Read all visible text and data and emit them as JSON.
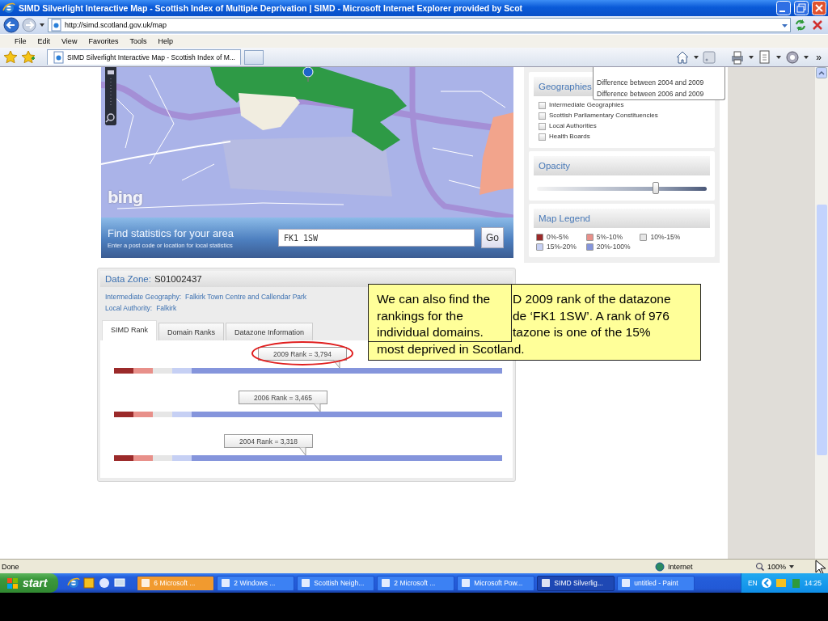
{
  "window": {
    "title": "SIMD Silverlight Interactive Map - Scottish Index of Multiple Deprivation | SIMD - Microsoft Internet Explorer provided by Scot"
  },
  "address_bar": {
    "url": "http://simd.scotland.gov.uk/map"
  },
  "menu": [
    "File",
    "Edit",
    "View",
    "Favorites",
    "Tools",
    "Help"
  ],
  "tabs": [
    {
      "label": "SIMD Silverlight Interactive Map - Scottish Index of M...",
      "selected": true
    }
  ],
  "toolbar_chevron": "»",
  "map": {
    "logo": "bing",
    "search": {
      "title": "Find statistics for your area",
      "hint": "Enter a post code or location for local statistics",
      "value": "FK1 1SW",
      "button": "Go"
    }
  },
  "side_panel": {
    "comparison_menu": [
      "Difference between 2004 and 2009",
      "Difference between 2006 and 2009"
    ],
    "geographies": {
      "title": "Geographies",
      "options": [
        {
          "label": "Intermediate Geographies",
          "checked": false
        },
        {
          "label": "Scottish Parliamentary Constituencies",
          "checked": false
        },
        {
          "label": "Local Authorities",
          "checked": false
        },
        {
          "label": "Health Boards",
          "checked": false
        }
      ]
    },
    "opacity": {
      "title": "Opacity",
      "level": 0.7
    },
    "legend": {
      "title": "Map Legend",
      "items": [
        {
          "label": "0%-5%",
          "color": "#9b2a2a"
        },
        {
          "label": "5%-10%",
          "color": "#e8908a"
        },
        {
          "label": "10%-15%",
          "color": "#e6e6e6"
        },
        {
          "label": "15%-20%",
          "color": "#c6d0f4"
        },
        {
          "label": "20%-100%",
          "color": "#8595dc"
        }
      ]
    }
  },
  "data_zone": {
    "label": "Data Zone:",
    "value": "S01002437",
    "details": [
      {
        "label": "Intermediate Geography:",
        "value": "Falkirk Town Centre and Callendar Park"
      },
      {
        "label": "Local Authority:",
        "value": "Falkirk"
      }
    ],
    "tabs": [
      {
        "label": "SIMD Rank",
        "selected": true
      },
      {
        "label": "Domain Ranks",
        "selected": false
      },
      {
        "label": "Datazone Information",
        "selected": false
      }
    ],
    "ranks": [
      {
        "label": "2009 Rank = 3,794",
        "level": 0.583,
        "circled": true
      },
      {
        "label": "2006 Rank = 3,465",
        "level": 0.533,
        "circled": false
      },
      {
        "label": "2004 Rank = 3,318",
        "level": 0.496,
        "circled": false
      }
    ]
  },
  "callouts": [
    {
      "text": "We can also find the rankings for the individual domains."
    },
    {
      "lines": [
        "D 2009 rank of the datazone",
        "de ‘FK1 1SW’. A rank of 976",
        "tazone is one of the 15%",
        "most deprived in Scotland."
      ]
    }
  ],
  "status_bar": {
    "text": "Done",
    "zone": "Internet",
    "zoom": "100%"
  },
  "taskbar": {
    "start": "start",
    "tasks": [
      {
        "label": "6 Microsoft ...",
        "selected": false,
        "flashing": true
      },
      {
        "label": "2 Windows ...",
        "selected": false,
        "flashing": false
      },
      {
        "label": "Scottish Neigh...",
        "selected": false,
        "flashing": false
      },
      {
        "label": "2 Microsoft ...",
        "selected": false,
        "flashing": false
      },
      {
        "label": "Microsoft Pow...",
        "selected": false,
        "flashing": false
      },
      {
        "label": "SIMD Silverlig...",
        "selected": true,
        "flashing": false
      },
      {
        "label": "untitled - Paint",
        "selected": false,
        "flashing": false
      }
    ],
    "language": "EN",
    "clock": "14:25"
  }
}
